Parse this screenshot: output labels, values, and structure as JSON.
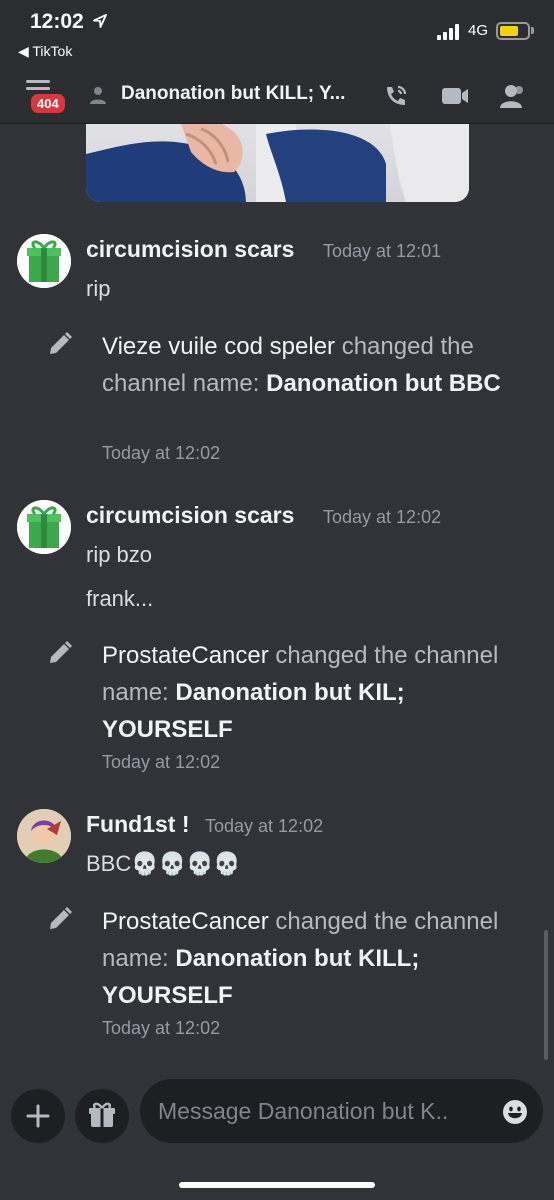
{
  "status_bar": {
    "time": "12:02",
    "back_app": "◀ TikTok",
    "network": "4G"
  },
  "header": {
    "badge": "404",
    "channel_title": "Danonation but KILL; Y...",
    "icons": [
      "hamburger-menu-icon",
      "dm-icon",
      "voice-call-icon",
      "video-call-icon",
      "members-icon"
    ]
  },
  "messages": [
    {
      "type": "user",
      "username": "circumcision scars",
      "timestamp": "Today at 12:01",
      "lines": [
        "rip"
      ]
    },
    {
      "type": "system",
      "actor": "Vieze vuile cod speler",
      "action": " changed the channel name: ",
      "new_name": "Danonation but BBC",
      "timestamp": "Today at 12:02"
    },
    {
      "type": "user",
      "username": "circumcision scars",
      "timestamp": "Today at 12:02",
      "lines": [
        "rip bzo",
        "frank..."
      ]
    },
    {
      "type": "system",
      "actor": "ProstateCancer",
      "action": " changed the channel name: ",
      "new_name": "Danonation but KIL; YOURSELF",
      "timestamp": "Today at 12:02"
    },
    {
      "type": "user",
      "username": "Fund1st !",
      "timestamp": "Today at 12:02",
      "lines": [
        "BBC💀💀💀💀"
      ]
    },
    {
      "type": "system",
      "actor": "ProstateCancer",
      "action": " changed the channel name: ",
      "new_name": "Danonation but KILL; YOURSELF",
      "timestamp": "Today at 12:02"
    }
  ],
  "composer": {
    "placeholder": "Message Danonation but K..",
    "icons": [
      "plus-icon",
      "gift-icon",
      "emoji-icon"
    ]
  },
  "colors": {
    "background": "#313338",
    "header": "#2b2d31",
    "badge": "#da373c",
    "battery": "#f5d30b"
  }
}
